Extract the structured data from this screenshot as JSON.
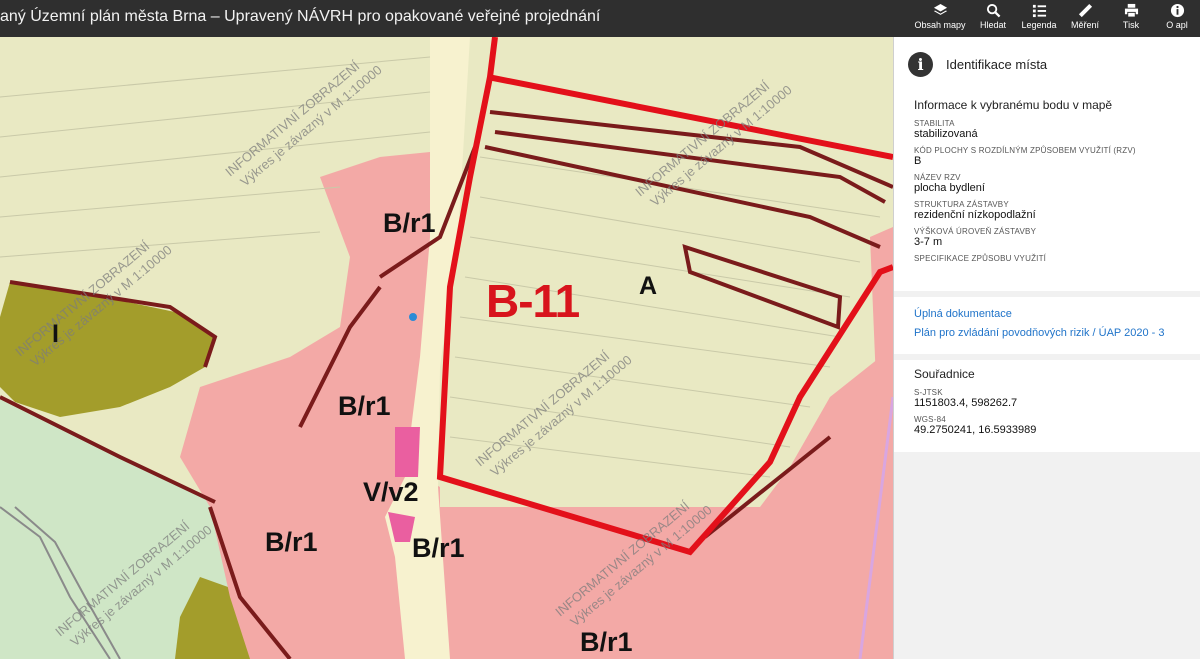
{
  "header": {
    "title": "aný Územní plán města Brna – Upravený NÁVRH pro opakované veřejné projednání",
    "tools": [
      {
        "label": "Obsah mapy",
        "icon": "layers-icon"
      },
      {
        "label": "Hledat",
        "icon": "search-icon"
      },
      {
        "label": "Legenda",
        "icon": "legend-icon"
      },
      {
        "label": "Měření",
        "icon": "ruler-icon"
      },
      {
        "label": "Tisk",
        "icon": "print-icon"
      },
      {
        "label": "O apl",
        "icon": "info-icon"
      }
    ]
  },
  "map": {
    "labels": {
      "br1_a": "B/r1",
      "br1_b": "B/r1",
      "br1_c": "B/r1",
      "br1_d": "B/r1",
      "br1_e": "B/r1",
      "vv2": "V/v2",
      "big": "B-11",
      "a": "A",
      "i": "I"
    },
    "watermark": "INFORMATIVNÍ ZOBRAZENÍ",
    "watermark2": "Výkres je závazný v M 1:10000"
  },
  "panel": {
    "title": "Identifikace místa",
    "info_section": "Informace k vybranému bodu v mapě",
    "fields": [
      {
        "key": "STABILITA",
        "value": "stabilizovaná"
      },
      {
        "key": "KÓD PLOCHY S ROZDÍLNÝM ZPŮSOBEM VYUŽITÍ (RZV)",
        "value": "B"
      },
      {
        "key": "NÁZEV RZV",
        "value": "plocha bydlení"
      },
      {
        "key": "STRUKTURA ZÁSTAVBY",
        "value": "rezidenční nízkopodlažní"
      },
      {
        "key": "VÝŠKOVÁ ÚROVEŇ ZÁSTAVBY",
        "value": "3-7 m"
      },
      {
        "key": "SPECIFIKACE ZPŮSOBU VYUŽITÍ",
        "value": ""
      }
    ],
    "links": [
      "Úplná dokumentace",
      "Plán pro zvládání povodňových rizik / ÚAP 2020 - 3"
    ],
    "coords_section": "Souřadnice",
    "coords": [
      {
        "key": "S-JTSK",
        "value": "1151803.4, 598262.7"
      },
      {
        "key": "WGS-84",
        "value": "49.2750241, 16.5933989"
      }
    ]
  },
  "colors": {
    "topbar": "#2f2f2f",
    "residential": "#f2a3a3",
    "meadow": "#e9e9c3",
    "industry": "#a09a2a",
    "boundary_red": "#e3101a",
    "parcel_brown": "#7a1b1b",
    "link": "#1f73c9"
  }
}
